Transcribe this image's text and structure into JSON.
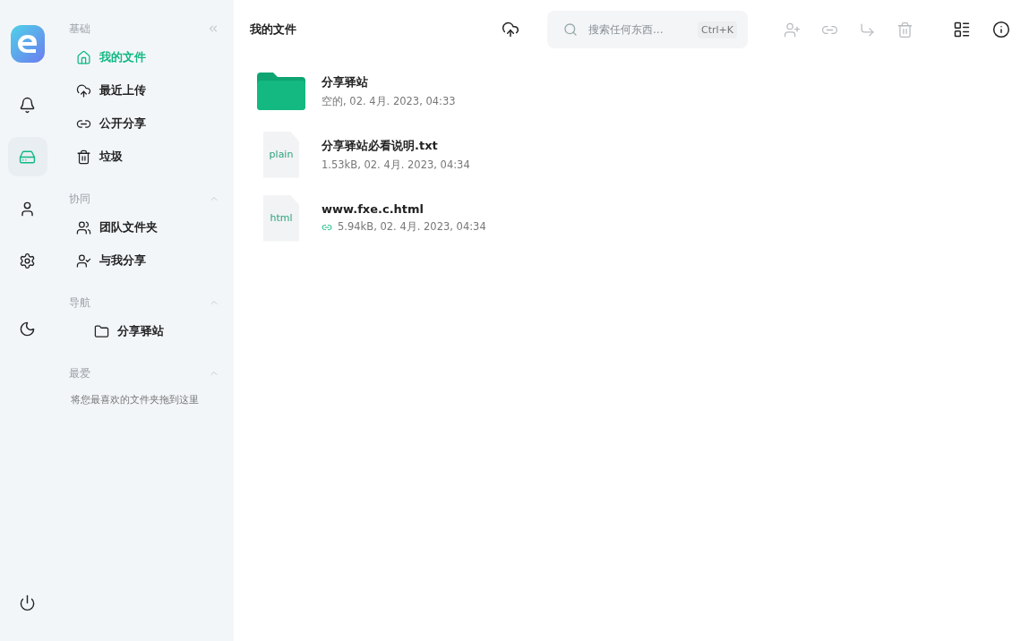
{
  "rail": {
    "items": [
      {
        "kind": "bell",
        "selected": false
      },
      {
        "kind": "drive",
        "selected": true
      },
      {
        "kind": "user",
        "selected": false
      },
      {
        "kind": "settings",
        "selected": false
      },
      {
        "kind": "moon",
        "selected": false
      }
    ],
    "bottom": {
      "kind": "power"
    }
  },
  "sidebar": {
    "sections": [
      {
        "title": "基础",
        "expanded": true,
        "items": [
          {
            "label": "我的文件",
            "kind": "home",
            "selected": true
          },
          {
            "label": "最近上传",
            "kind": "upload",
            "selected": false
          },
          {
            "label": "公开分享",
            "kind": "link",
            "selected": false
          },
          {
            "label": "垃圾",
            "kind": "trash",
            "selected": false
          }
        ]
      },
      {
        "title": "协同",
        "expanded": true,
        "items": [
          {
            "label": "团队文件夹",
            "kind": "users",
            "selected": false
          },
          {
            "label": "与我分享",
            "kind": "usercheck",
            "selected": false
          }
        ]
      },
      {
        "title": "导航",
        "expanded": true,
        "tree": [
          {
            "label": "分享驿站",
            "kind": "folder",
            "selected": false
          }
        ]
      },
      {
        "title": "最爱",
        "expanded": true,
        "hint": "将您最喜欢的文件夹拖到这里"
      }
    ]
  },
  "header": {
    "title": "我的文件",
    "search": {
      "placeholder": "搜索任何东西...",
      "shortcut": "Ctrl+K"
    },
    "actions": [
      {
        "kind": "share",
        "disabled": true
      },
      {
        "kind": "link",
        "disabled": true
      },
      {
        "kind": "move",
        "disabled": true
      },
      {
        "kind": "delete",
        "disabled": true
      }
    ]
  },
  "files": [
    {
      "kind": "folder",
      "name": "分享驿站",
      "meta": "空的, 02. 4月. 2023, 04:33",
      "shared": false
    },
    {
      "kind": "file",
      "type": "plain",
      "name": "分享驿站必看说明.txt",
      "meta": "1.53kB, 02. 4月. 2023, 04:34",
      "shared": false
    },
    {
      "kind": "file",
      "type": "html",
      "name": "www.fxe.c.html",
      "meta": "5.94kB, 02. 4月. 2023, 04:34",
      "shared": true
    }
  ]
}
